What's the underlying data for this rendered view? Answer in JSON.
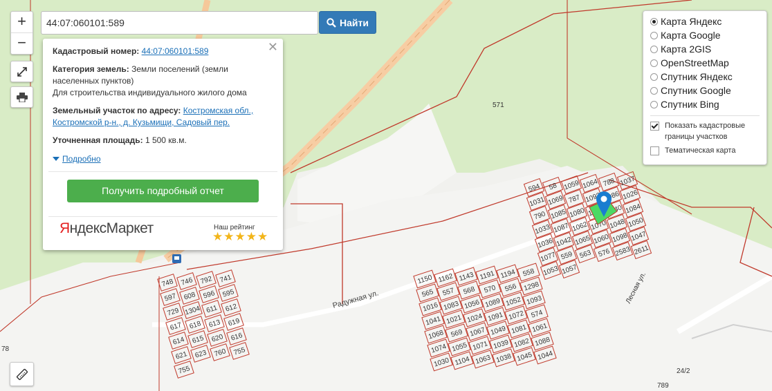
{
  "map": {
    "area_label": "571",
    "street_label": "Радужная ул.",
    "side_street_label": "Лесная ул.",
    "edge_label": "78",
    "corner_label": "789",
    "corner_label2": "24/2",
    "plots_left": [
      "748",
      "746",
      "792",
      "741",
      "597",
      "608",
      "596",
      "595",
      "729",
      "1304",
      "611",
      "612",
      "617",
      "618",
      "613",
      "619",
      "614",
      "615",
      "620",
      "616",
      "621",
      "623",
      "760",
      "755",
      "755"
    ],
    "plots_center": [
      "1150",
      "1162",
      "1143",
      "1191",
      "1194",
      "558",
      "565",
      "557",
      "568",
      "570",
      "556",
      "1298",
      "1016",
      "1083",
      "1056",
      "1089",
      "1052",
      "1093",
      "1041",
      "1021",
      "1024",
      "1091",
      "1072",
      "574",
      "1068",
      "569",
      "1067",
      "1049",
      "1081",
      "1061",
      "1074",
      "1055",
      "1071",
      "1039",
      "1082",
      "1088",
      "1030",
      "1104",
      "1063",
      "1038",
      "1045",
      "1044"
    ],
    "plots_right": [
      "594",
      "58",
      "1059",
      "1064",
      "788",
      "1037",
      "1031",
      "1069",
      "787",
      "1092",
      "1086",
      "1026",
      "790",
      "1085",
      "1080",
      "1073",
      "1040",
      "1084",
      "1033",
      "1087",
      "1062",
      "1070",
      "1048",
      "1050",
      "1036",
      "1042",
      "1065",
      "1060",
      "1098",
      "1047",
      "1077",
      "559",
      "563",
      "576",
      "2583",
      "2611",
      "1053",
      "1057"
    ]
  },
  "controls": {
    "zoom_in": "+",
    "zoom_out": "−"
  },
  "search": {
    "value": "44:07:060101:589",
    "button_label": "Найти"
  },
  "popup": {
    "cadastral_label": "Кадастровый номер:",
    "cadastral_value": "44:07:060101:589",
    "category_label": "Категория земель:",
    "category_value": "Земли поселений (земли населенных пунктов)",
    "usage_value": "Для строительства индивидуального жилого дома",
    "address_label": "Земельный участок по адресу:",
    "address_value": "Костромская обл., Костромской р-н., д. Кузьмищи, Садовый пер.",
    "area_label": "Уточненная площадь:",
    "area_value": "1 500 кв.м.",
    "more_link": "Подробно",
    "report_button": "Получить подробный отчет",
    "ym_logo_part1": "Я",
    "ym_logo_part2": "ндекс",
    "ym_logo_part3": "Маркет",
    "rating_label": "Наш рейтинг",
    "rating_stars": "★★★★★",
    "rating_value": 5
  },
  "layers": {
    "options": [
      "Карта Яндекс",
      "Карта Google",
      "Карта 2GIS",
      "OpenStreetMap",
      "Спутник Яндекс",
      "Спутник Google",
      "Спутник Bing"
    ],
    "selected": "Карта Яндекс",
    "show_borders_label": "Показать кадастровые границы участков",
    "show_borders_checked": true,
    "thematic_label": "Тематическая карта",
    "thematic_checked": false
  },
  "colors": {
    "boundary": "#c0392b",
    "forest": "#d7ebc3",
    "selected_plot": "#4cd964",
    "marker": "#1a7dd0",
    "search_button": "#337ab7",
    "report_button": "#4cae4c"
  }
}
